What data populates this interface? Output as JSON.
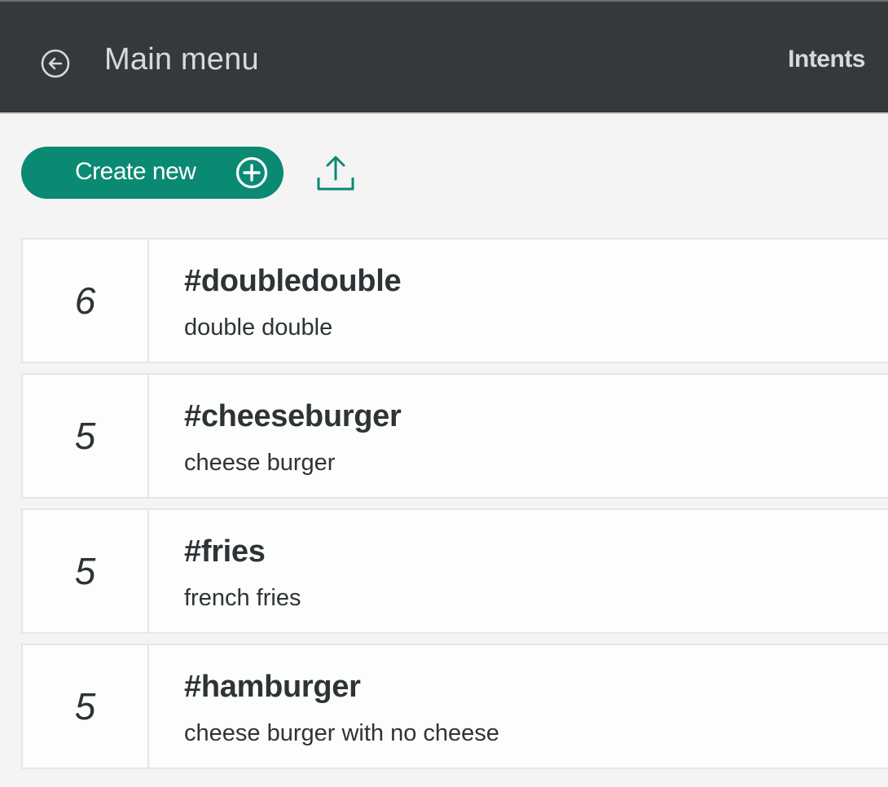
{
  "header": {
    "back_label": "Main menu",
    "section_title": "Intents",
    "back_icon": "circle-arrow-left-icon"
  },
  "toolbar": {
    "create_label": "Create new",
    "create_icon": "circle-plus-icon",
    "upload_icon": "upload-icon",
    "accent_color": "#0a8a72"
  },
  "intents": [
    {
      "count": "6",
      "name": "#doubledouble",
      "description": "double double"
    },
    {
      "count": "5",
      "name": "#cheeseburger",
      "description": "cheese burger"
    },
    {
      "count": "5",
      "name": "#fries",
      "description": "french fries"
    },
    {
      "count": "5",
      "name": "#hamburger",
      "description": "cheese burger with no cheese"
    }
  ]
}
